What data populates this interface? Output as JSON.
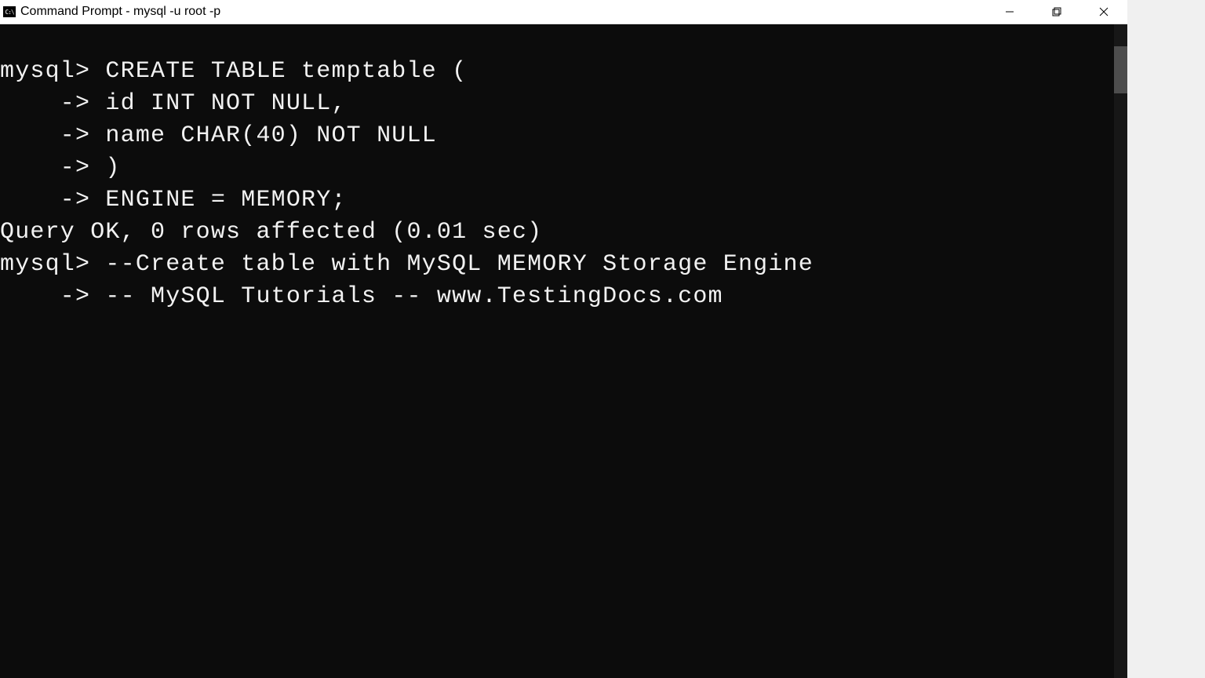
{
  "window": {
    "title": "Command Prompt - mysql  -u root -p",
    "icon_label": "cmd-icon"
  },
  "terminal": {
    "lines": [
      "mysql> CREATE TABLE temptable (",
      "    -> id INT NOT NULL,",
      "    -> name CHAR(40) NOT NULL",
      "    -> )",
      "    -> ENGINE = MEMORY;",
      "Query OK, 0 rows affected (0.01 sec)",
      "",
      "mysql> --Create table with MySQL MEMORY Storage Engine",
      "    -> -- MySQL Tutorials -- www.TestingDocs.com"
    ]
  }
}
